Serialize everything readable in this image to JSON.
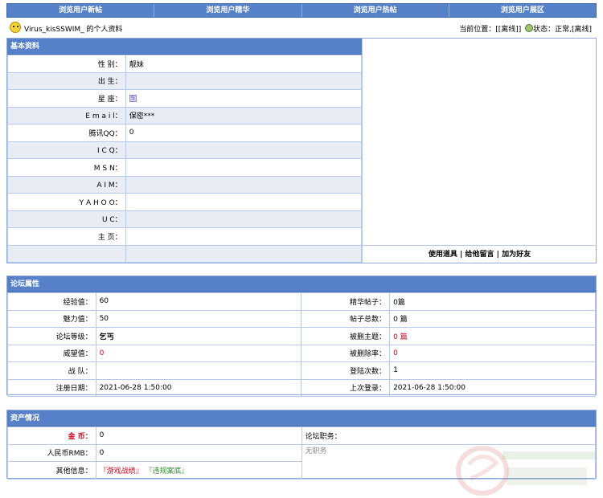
{
  "topnav": {
    "tabs": [
      "浏览用户新帖",
      "浏览用户精华",
      "浏览用户热帖",
      "浏览用户展区"
    ]
  },
  "userbar": {
    "title": "Virus_kisSSWIM_ 的个人资料",
    "location": "当前位置：[[离线]]",
    "status": "状态：正常,[离线]"
  },
  "basic": {
    "title": "基本资料",
    "rows": [
      {
        "label": "性 别：",
        "value": "靓妹"
      },
      {
        "label": "出 生：",
        "value": ""
      },
      {
        "label": "星 座：",
        "value": ""
      },
      {
        "label": "E m a i l：",
        "value": "保密***"
      },
      {
        "label": "腾讯QQ：",
        "value": "0"
      },
      {
        "label": "I C Q：",
        "value": ""
      },
      {
        "label": "M S N：",
        "value": ""
      },
      {
        "label": "A I M：",
        "value": ""
      },
      {
        "label": "Y A H O O：",
        "value": ""
      },
      {
        "label": "U C：",
        "value": ""
      },
      {
        "label": "主 页：",
        "value": ""
      },
      {
        "label": "",
        "value": ""
      }
    ],
    "actions": {
      "tool": "使用道具",
      "message": "给他留言",
      "friend": "加为好友"
    }
  },
  "forum": {
    "title": "论坛属性",
    "rows": [
      {
        "l1": "经验值：",
        "v1": "60",
        "l2": "精华帖子：",
        "v2": "0篇"
      },
      {
        "l1": "魅力值：",
        "v1": "50",
        "l2": "帖子总数：",
        "v2": "0 篇"
      },
      {
        "l1": "论坛等级：",
        "v1": "乞丐",
        "l2": "被删主题：",
        "v2": "0 篇"
      },
      {
        "l1": "威望值：",
        "v1": "0",
        "l2": "被删除率：",
        "v2": "0"
      },
      {
        "l1": "战 队：",
        "v1": "",
        "l2": "登陆次数：",
        "v2": "1"
      },
      {
        "l1": "注册日期：",
        "v1": "2021-06-28 1:50:00",
        "l2": "上次登录：",
        "v2": "2021-06-28 1:50:00"
      }
    ]
  },
  "assets": {
    "title": "资产情况",
    "coin_label": "金 币：",
    "coin_value": "0",
    "rmb_label": "人民币RMB：",
    "rmb_value": "0",
    "other_label": "其他信息：",
    "other_links": [
      "『游戏战绩』",
      "『违规案底』"
    ],
    "duty_label": "论坛职务：",
    "duty_value": "无职务"
  },
  "colors": {
    "header": "#5680c7",
    "row_shade": "#e8edf5",
    "accent_red": "#d0021b"
  },
  "icons": {
    "avatar": "smiley-icon",
    "status": "online-status-icon",
    "zodiac": "zodiac-sign-icon"
  }
}
